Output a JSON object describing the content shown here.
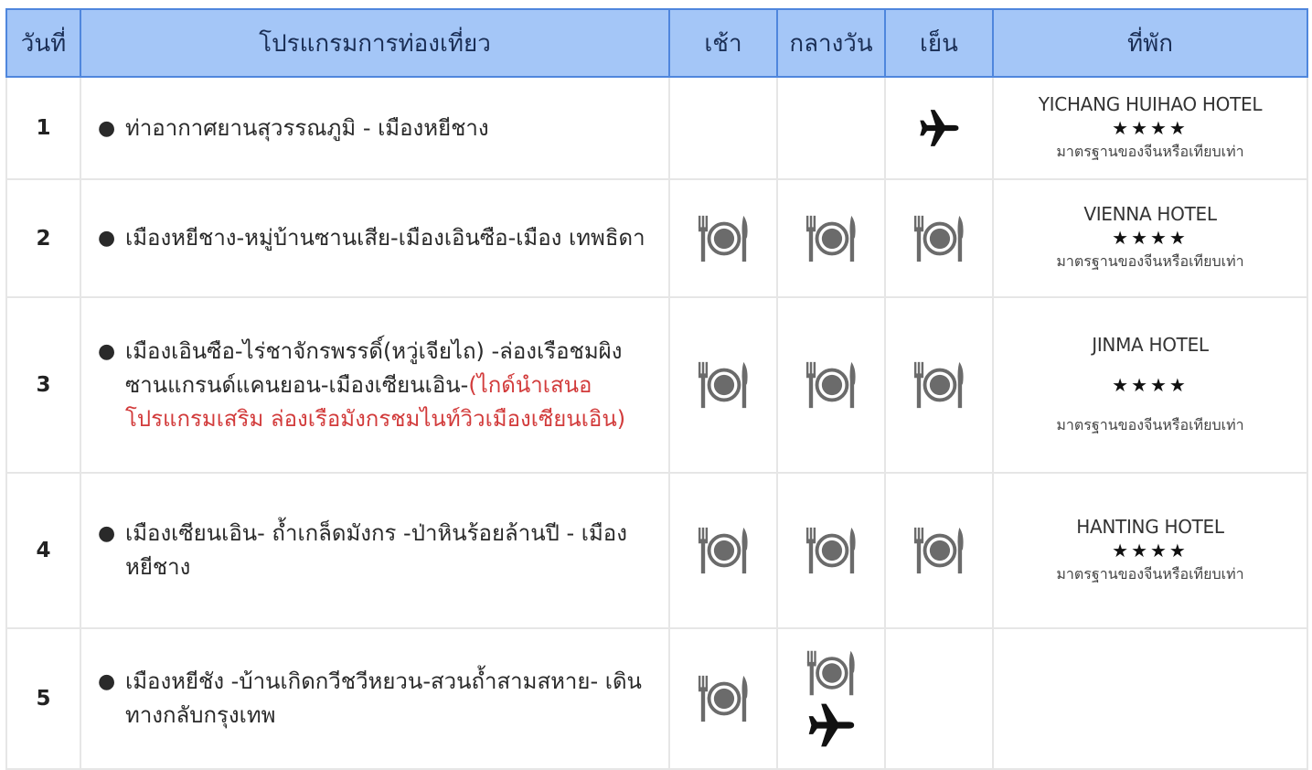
{
  "headers": {
    "day": "วันที่",
    "program": "โปรแกรมการท่องเที่ยว",
    "breakfast": "เช้า",
    "lunch": "กลางวัน",
    "dinner": "เย็น",
    "hotel": "ที่พัก"
  },
  "icons": {
    "meal": "plate-fork-knife-icon",
    "flight": "airplane-icon"
  },
  "colors": {
    "header_bg": "#a4c6f7",
    "header_border": "#4f86dd",
    "highlight": "#d23b3b"
  },
  "rows": [
    {
      "day": "1",
      "program": "ท่าอากาศยานสุวรรณภูมิ - เมืองหยีชาง",
      "breakfast": "",
      "lunch": "",
      "dinner": "airplane",
      "hotel": {
        "name": "YICHANG HUIHAO HOTEL",
        "stars": "★★★★",
        "note": "มาตรฐานของจีนหรือเทียบเท่า"
      }
    },
    {
      "day": "2",
      "program": "เมืองหยีชาง-หมู่บ้านซานเสีย-เมืองเอินซือ-เมือง เทพธิดา",
      "breakfast": "meal",
      "lunch": "meal",
      "dinner": "meal",
      "hotel": {
        "name": "VIENNA HOTEL",
        "stars": "★★★★",
        "note": "มาตรฐานของจีนหรือเทียบเท่า"
      }
    },
    {
      "day": "3",
      "program": "เมืองเอินซือ-ไร่ชาจักรพรรดิ์(หวู่เจียไถ) -ล่องเรือชมผิง ซานแกรนด์แคนยอน-เมืองเซียนเอิน-",
      "program_highlight": "(ไกด์นำเสนอ โปรแกรมเสริม ล่องเรือมังกรชมไนท์วิวเมืองเซียนเอิน)",
      "breakfast": "meal",
      "lunch": "meal",
      "dinner": "meal",
      "hotel": {
        "name": "JINMA HOTEL",
        "stars": "★★★★",
        "note": "มาตรฐานของจีนหรือเทียบเท่า"
      }
    },
    {
      "day": "4",
      "program": "เมืองเซียนเอิน- ถ้ำเกล็ดมังกร -ป่าหินร้อยล้านปี - เมือง หยีชาง",
      "breakfast": "meal",
      "lunch": "meal",
      "dinner": "meal",
      "hotel": {
        "name": "HANTING HOTEL",
        "stars": "★★★★",
        "note": "มาตรฐานของจีนหรือเทียบเท่า"
      }
    },
    {
      "day": "5",
      "program": "เมืองหยีชัง -บ้านเกิดกวีชวีหยวน-สวนถ้ำสามสหาย- เดินทางกลับกรุงเทพ",
      "breakfast": "meal",
      "lunch": "meal + airplane",
      "dinner": "",
      "hotel": {
        "name": "",
        "stars": "",
        "note": ""
      }
    }
  ]
}
